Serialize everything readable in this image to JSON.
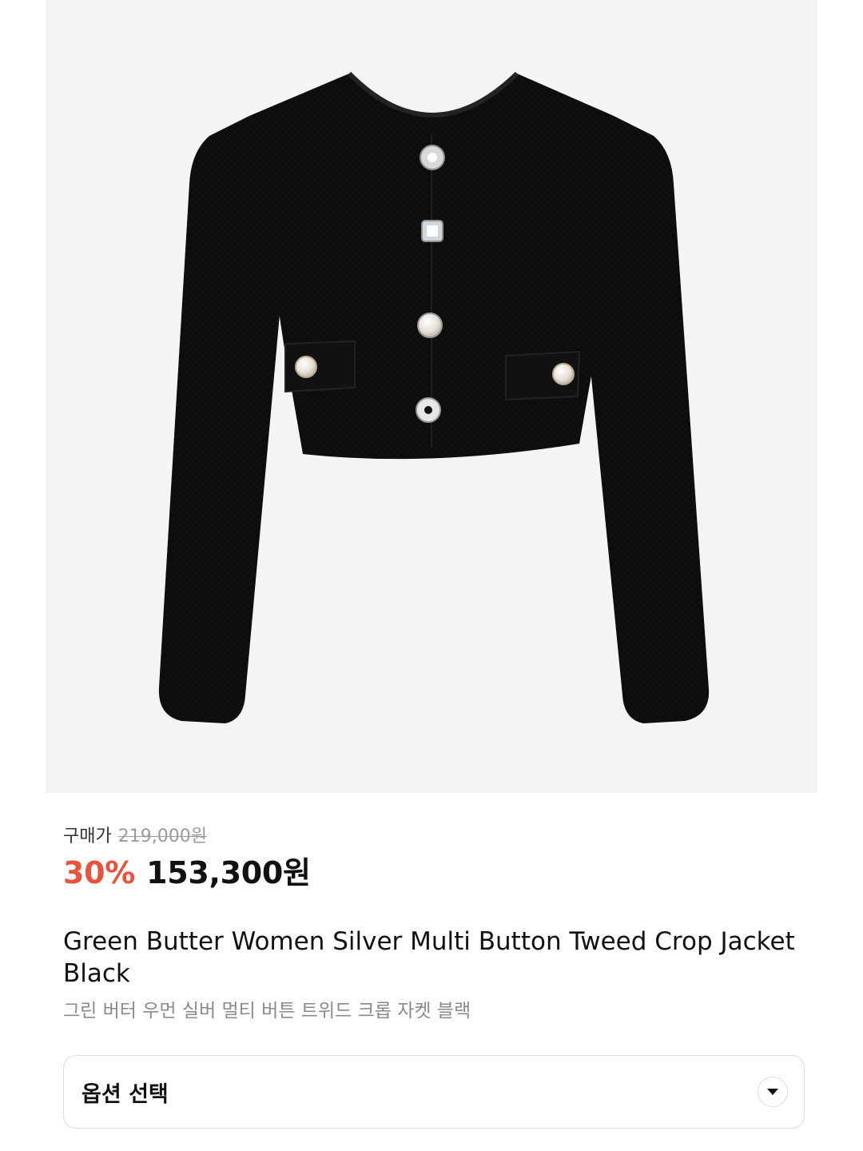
{
  "product": {
    "image_label": "Black tweed crop jacket with silver jewel buttons",
    "purchase_label": "구매가",
    "original_price": "219,000원",
    "discount": "30%",
    "sale_price": "153,300원",
    "title_en": "Green Butter Women Silver Multi Button Tweed Crop Jacket Black",
    "title_ko": "그린 버터 우먼 실버 멀티 버튼 트위드 크롭 자켓 블랙"
  },
  "option": {
    "label": "옵션 선택",
    "icon": "chevron-down-icon"
  },
  "colors": {
    "discount": "#e8533e",
    "image_bg": "#f4f4f4",
    "text_primary": "#111111",
    "text_secondary": "#8a8a8a"
  }
}
